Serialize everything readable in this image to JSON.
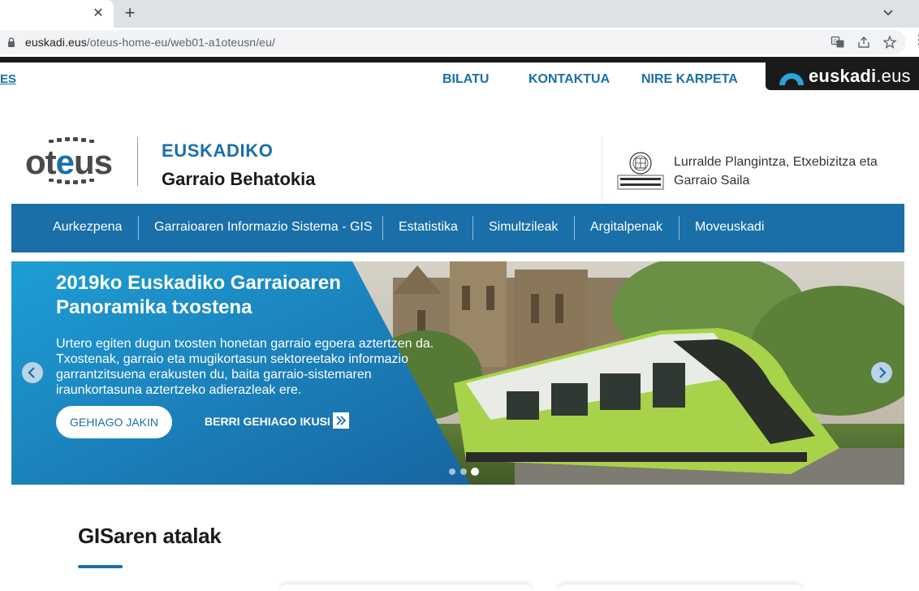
{
  "browser": {
    "tab_close_glyph": "✕",
    "new_tab_glyph": "+",
    "url_host": "euskadi.eus",
    "url_path": "/oteus-home-eu/web01-a1oteusn/eu/"
  },
  "topnav": {
    "lang_es": "ES",
    "links": [
      "BILATU",
      "KONTAKTUA",
      "NIRE KARPETA"
    ],
    "euskadi_brand": "euskadi",
    "euskadi_tld": ".eus"
  },
  "header": {
    "logo_prefix": "ot",
    "logo_accent": "e",
    "logo_suffix": "us",
    "kicker": "EUSKADIKO",
    "title": "Garraio Behatokia",
    "department": "Lurralde Plangintza, Etxebizitza eta Garraio Saila"
  },
  "mainnav": {
    "items": [
      "Aurkezpena",
      "Garraioaren Informazio Sistema - GIS",
      "Estatistika",
      "Simultzileak",
      "Argitalpenak",
      "Moveuskadi"
    ]
  },
  "hero": {
    "title": "2019ko Euskadiko Garraioaren Panoramika txostena",
    "body": "Urtero egiten dugun txosten honetan garraio egoera aztertzen da. Txostenak, garraio eta mugikortasun sektoreetako informazio garrantzitsuena erakusten du, baita garraio-sistemaren iraunkortasuna aztertzeko adierazleak ere.",
    "button_label": "GEHIAGO JAKIN",
    "more_news_label": "BERRI GEHIAGO IKUSI",
    "slide_count": 3,
    "active_slide": 3
  },
  "section": {
    "title": "GISaren atalak"
  },
  "colors": {
    "brand_blue": "#1a6fa8",
    "chrome_gray": "#dee1e6"
  }
}
